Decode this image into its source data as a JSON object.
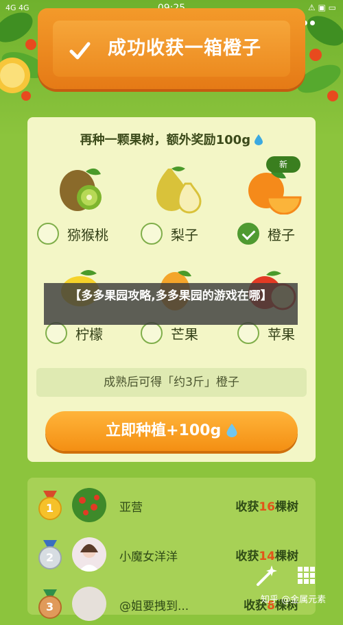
{
  "status_bar": {
    "left": "4G 4G",
    "time": "09:25",
    "right": "⚠ ▣ ▭"
  },
  "banner": {
    "title": "成功收获一箱橙子"
  },
  "card": {
    "subtitle": "再种一颗果树，额外奖励100g",
    "new_badge": "新",
    "fruits": [
      {
        "label": "猕猴桃",
        "checked": false
      },
      {
        "label": "梨子",
        "checked": false
      },
      {
        "label": "橙子",
        "checked": true
      },
      {
        "label": "柠檬",
        "checked": false
      },
      {
        "label": "芒果",
        "checked": false
      },
      {
        "label": "苹果",
        "checked": false
      }
    ],
    "result_text": "成熟后可得「约3斤」橙子",
    "plant_button": "立即种植+100g"
  },
  "overlay_title": "【多多果园攻略,多多果园的游戏在哪】",
  "ranking": [
    {
      "rank": "1",
      "name": "亚营",
      "harvest_prefix": "收获",
      "harvest_count": "16",
      "harvest_suffix": "棵树"
    },
    {
      "rank": "2",
      "name": "小魔女洋洋",
      "harvest_prefix": "收获",
      "harvest_count": "14",
      "harvest_suffix": "棵树"
    },
    {
      "rank": "3",
      "name": "@姐要拽到...",
      "harvest_prefix": "收获",
      "harvest_count": "8",
      "harvest_suffix": "棵树"
    }
  ],
  "watermark": "知乎 @金属元素",
  "colors": {
    "accent_orange": "#f48f13",
    "green_dark": "#3a7e1f",
    "highlight_num": "#e2541a"
  }
}
